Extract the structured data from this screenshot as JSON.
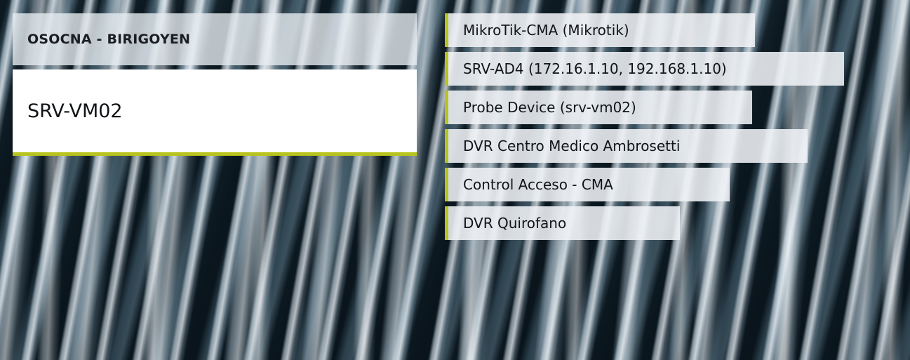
{
  "header": {
    "title": "OSOCNA - BIRIGOYEN"
  },
  "device": {
    "name": "SRV-VM02"
  },
  "dependencies": [
    {
      "label": "MikroTik-CMA (Mikrotik)"
    },
    {
      "label": "SRV-AD4 (172.16.1.10, 192.168.1.10)"
    },
    {
      "label": "Probe Device (srv-vm02)"
    },
    {
      "label": "DVR Centro Medico Ambrosetti"
    },
    {
      "label": "Control Acceso - CMA"
    },
    {
      "label": "DVR Quirofano"
    }
  ],
  "colors": {
    "accent": "#b8c41d",
    "panel": "#ffffff"
  }
}
